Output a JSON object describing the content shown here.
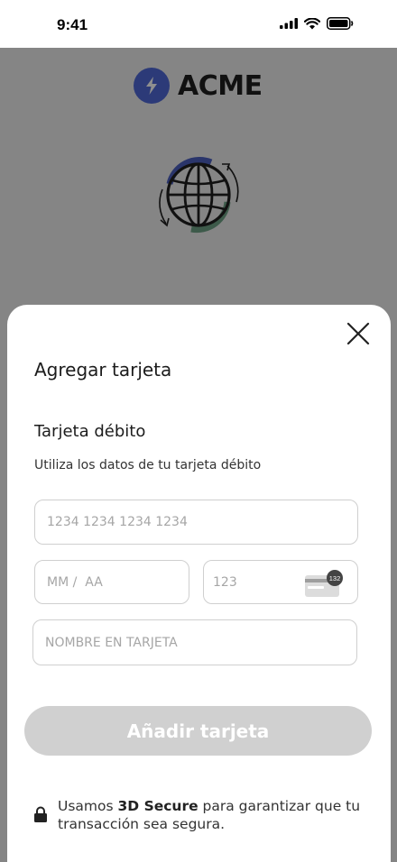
{
  "status_bar": {
    "time": "9:41"
  },
  "brand": {
    "name": "ACME",
    "color": "#2c3a78"
  },
  "sheet": {
    "title": "Agregar tarjeta",
    "section_title": "Tarjeta débito",
    "section_subtitle": "Utiliza los datos de tu tarjeta débito"
  },
  "form": {
    "card_number_placeholder": "1234 1234 1234 1234",
    "expiry_placeholder": "MM /  AA",
    "cvv_placeholder": "123",
    "cvv_icon_badge": "132",
    "name_placeholder": "NOMBRE EN TARJETA"
  },
  "submit": {
    "label": "Añadir tarjeta"
  },
  "security": {
    "prefix": "Usamos ",
    "highlight": "3D Secure",
    "suffix": " para garantizar que tu transacción sea segura."
  },
  "icons": [
    "signal-icon",
    "wifi-icon",
    "battery-icon",
    "bolt-icon",
    "globe-icon",
    "close-icon",
    "card-icon",
    "lock-icon"
  ]
}
